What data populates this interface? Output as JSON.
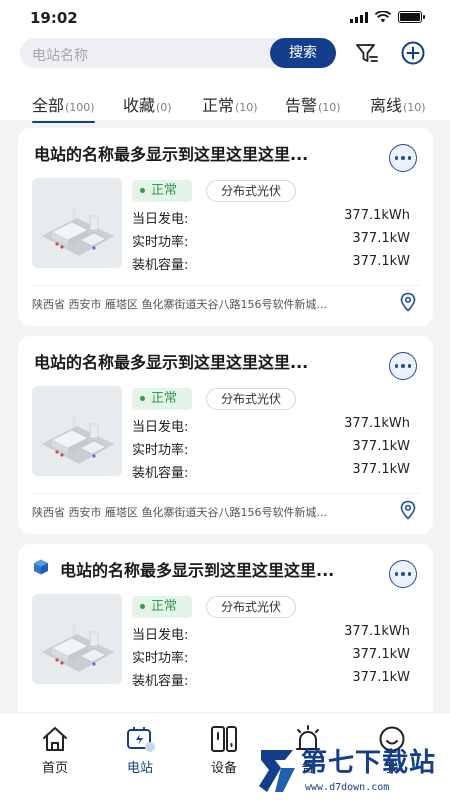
{
  "status": {
    "time": "19:02"
  },
  "search": {
    "placeholder": "电站名称",
    "button_label": "搜索"
  },
  "tabs": [
    {
      "label": "全部",
      "count": "(100)",
      "active": true
    },
    {
      "label": "收藏",
      "count": "(0)"
    },
    {
      "label": "正常",
      "count": "(10)"
    },
    {
      "label": "告警",
      "count": "(10)"
    },
    {
      "label": "离线",
      "count": "(10)"
    }
  ],
  "stations": [
    {
      "name": "电站的名称最多显示到这里这里这里...",
      "status": "正常",
      "type": "分布式光伏",
      "metrics": [
        {
          "label": "当日发电:",
          "value": "377.1kWh"
        },
        {
          "label": "实时功率:",
          "value": "377.1kW"
        },
        {
          "label": "装机容量:",
          "value": "377.1kW"
        }
      ],
      "address": "陕西省 西安市 雁塔区 鱼化寨街道天谷八路156号软件新城..."
    },
    {
      "name": "电站的名称最多显示到这里这里这里...",
      "status": "正常",
      "type": "分布式光伏",
      "metrics": [
        {
          "label": "当日发电:",
          "value": "377.1kWh"
        },
        {
          "label": "实时功率:",
          "value": "377.1kW"
        },
        {
          "label": "装机容量:",
          "value": "377.1kW"
        }
      ],
      "address": "陕西省 西安市 雁塔区 鱼化寨街道天谷八路156号软件新城..."
    },
    {
      "name": "电站的名称最多显示到这里这里这里...",
      "status": "正常",
      "type": "分布式光伏",
      "metrics": [
        {
          "label": "当日发电:",
          "value": "377.1kWh"
        },
        {
          "label": "实时功率:",
          "value": "377.1kW"
        },
        {
          "label": "装机容量:",
          "value": "377.1kW"
        }
      ]
    }
  ],
  "nav": [
    {
      "label": "首页",
      "icon": "home-icon"
    },
    {
      "label": "电站",
      "icon": "station-icon",
      "active": true
    },
    {
      "label": "设备",
      "icon": "device-icon"
    },
    {
      "label": "告",
      "icon": "alarm-icon"
    },
    {
      "label": "我",
      "icon": "profile-icon"
    }
  ],
  "watermark": {
    "title": "第七下载站",
    "url": "www.d7down.com"
  },
  "colors": {
    "primary": "#123e8c",
    "ok_green": "#2f9a50",
    "background": "#f2f3f5"
  }
}
